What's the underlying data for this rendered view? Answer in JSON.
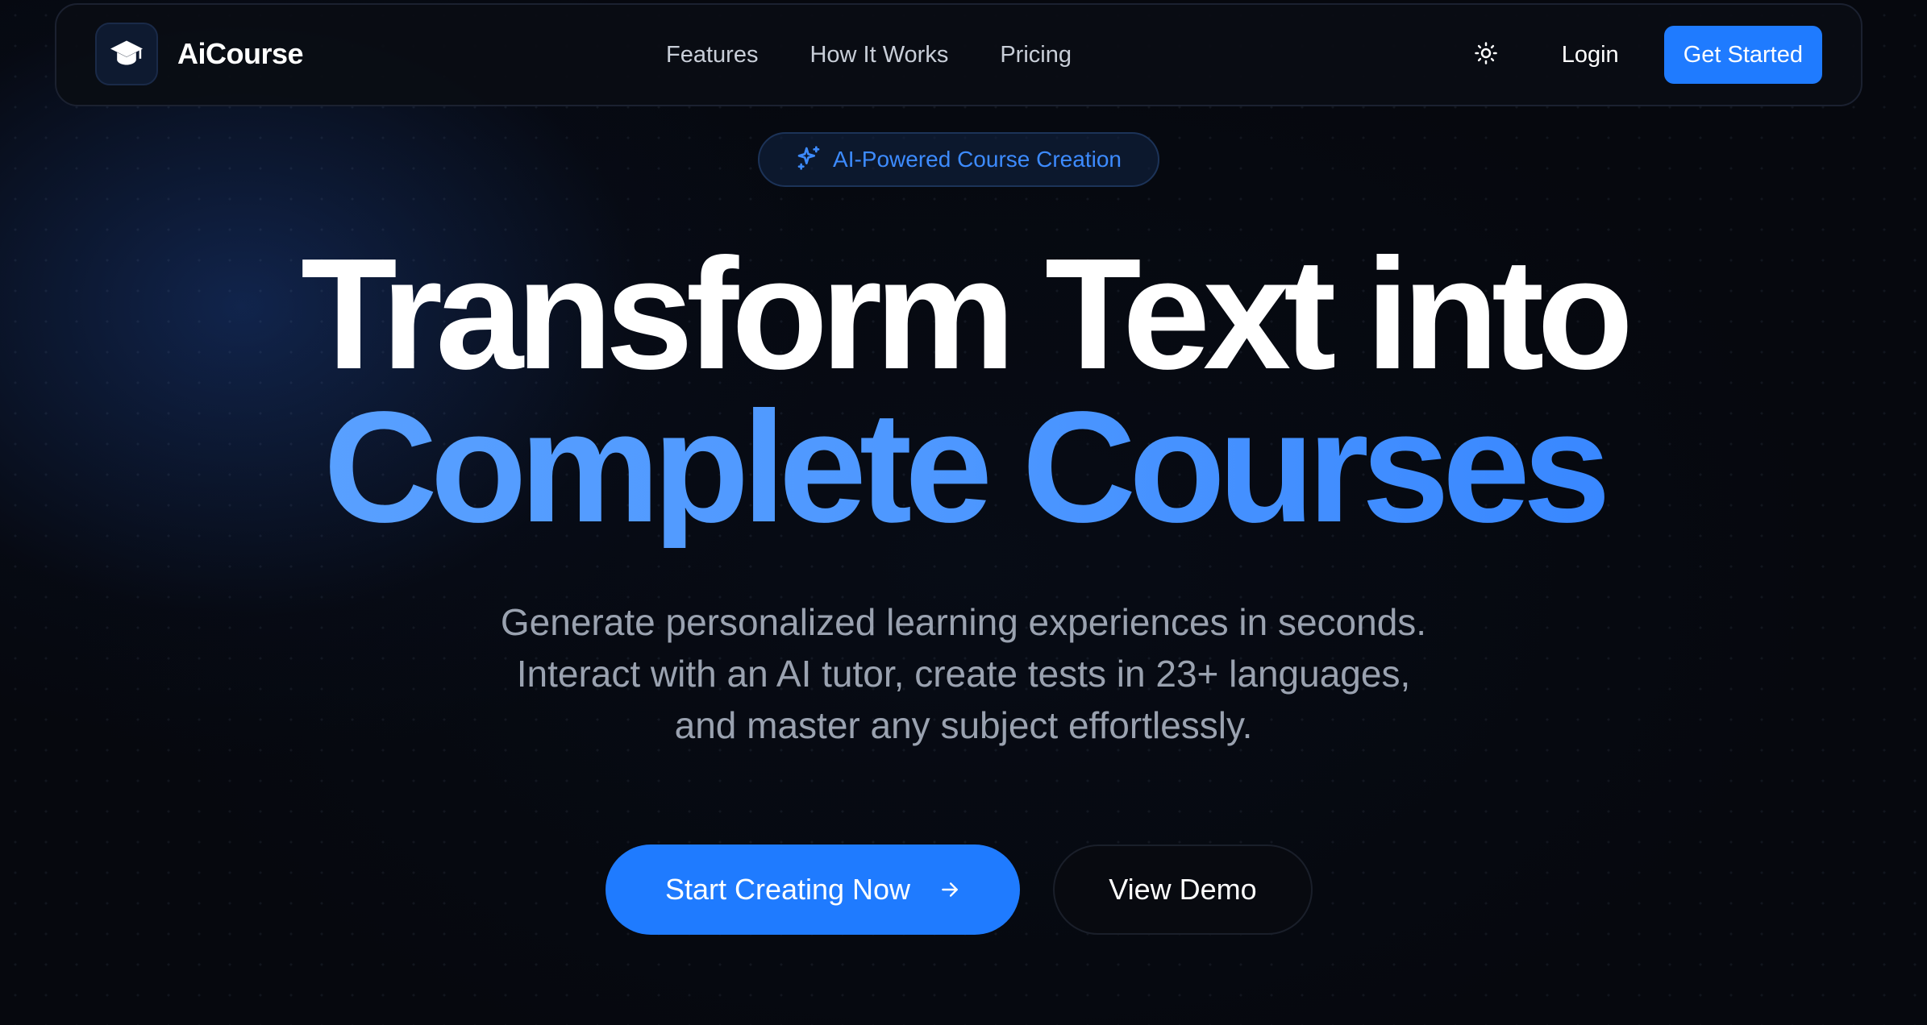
{
  "navbar": {
    "brand": "AiCourse",
    "links": [
      "Features",
      "How It Works",
      "Pricing"
    ],
    "login": "Login",
    "get_started": "Get Started"
  },
  "hero": {
    "badge": "AI-Powered Course Creation",
    "headline_line1": "Transform Text into",
    "headline_line2": "Complete Courses",
    "subtitle": "Generate personalized learning experiences in seconds. Interact with an AI tutor, create tests in 23+ languages, and master any subject effortlessly.",
    "cta_primary": "Start Creating Now",
    "cta_secondary": "View Demo"
  },
  "icons": {
    "logo": "graduation-cap-icon",
    "theme_toggle": "sun-icon",
    "badge": "sparkles-icon",
    "cta_primary": "arrow-right-icon"
  },
  "colors": {
    "accent": "#1f7bff",
    "headline_gradient_start": "#5ea4ff",
    "headline_gradient_end": "#2f80ff",
    "background": "#06080e"
  }
}
